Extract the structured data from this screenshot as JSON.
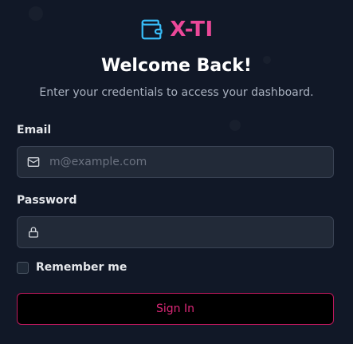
{
  "brand": {
    "name": "X-TI",
    "icon": "wallet-icon",
    "accent_color": "#ec4899"
  },
  "header": {
    "title": "Welcome Back!",
    "subtitle": "Enter your credentials to access your dashboard."
  },
  "form": {
    "email": {
      "label": "Email",
      "placeholder": "m@example.com",
      "value": "",
      "icon": "mail-icon"
    },
    "password": {
      "label": "Password",
      "placeholder": "",
      "value": "",
      "icon": "lock-icon"
    },
    "remember": {
      "label": "Remember me",
      "checked": false
    },
    "submit_label": "Sign In"
  },
  "colors": {
    "background": "#111827",
    "input_background": "#222a38",
    "button_border": "#be185d",
    "button_text": "#db2777"
  }
}
